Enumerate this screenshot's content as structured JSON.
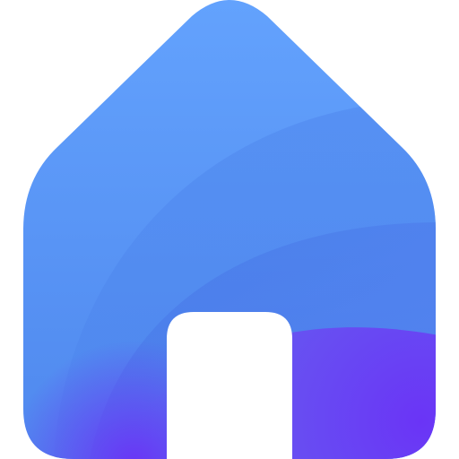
{
  "icon": {
    "name": "home-icon",
    "colors": {
      "top": "#63A2FD",
      "mid": "#4F88EE",
      "deep": "#3E6FE0",
      "violet": "#6A34F6",
      "violet_light": "#8B4DFC",
      "door": "#FFFFFF",
      "background": "#FFFFFF"
    }
  }
}
